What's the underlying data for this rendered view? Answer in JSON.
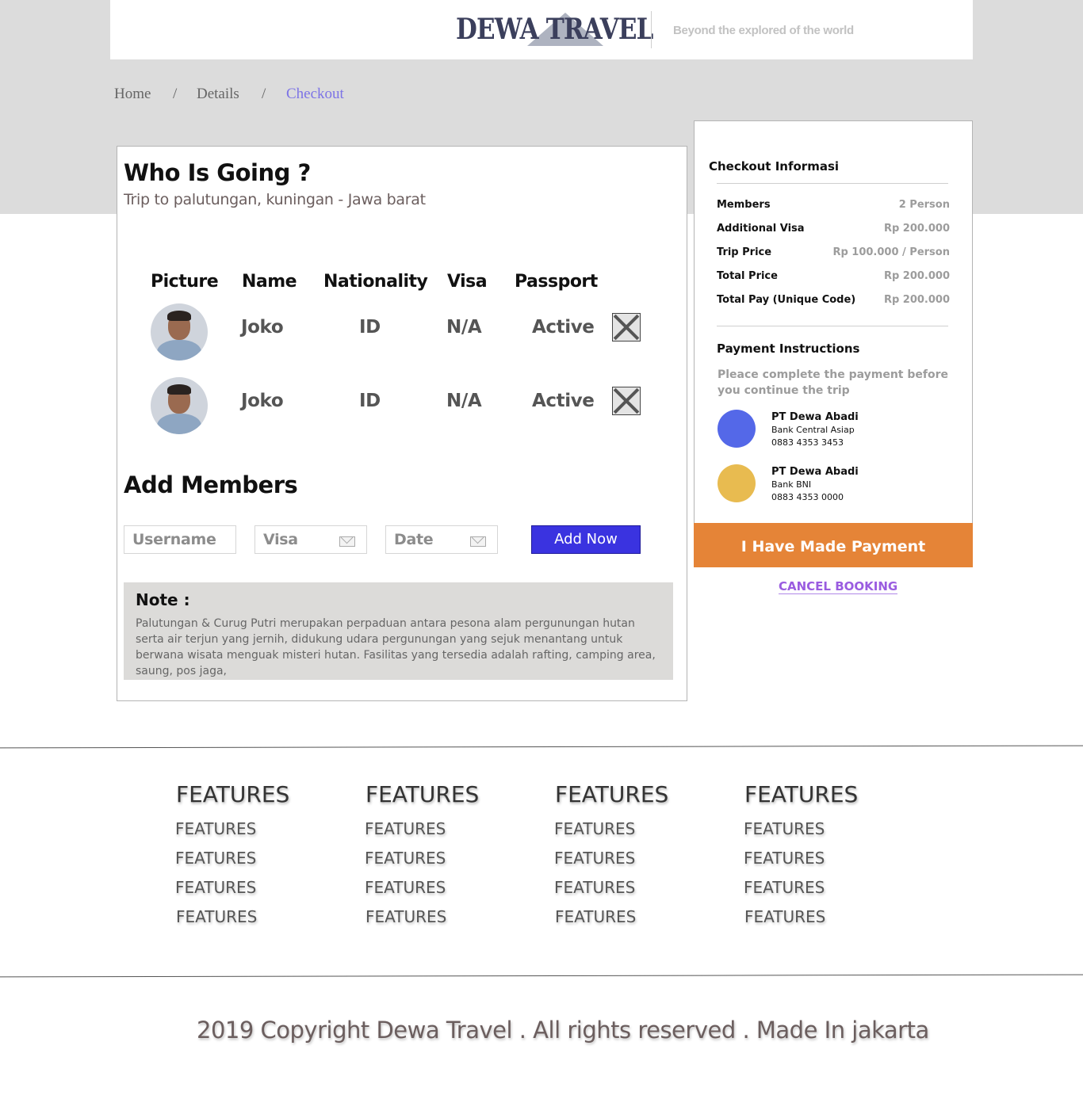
{
  "brand": {
    "logo_text": "DEWA TRAVEL",
    "tagline": "Beyond the explored of the world"
  },
  "breadcrumb": {
    "items": [
      "Home",
      "Details",
      "Checkout"
    ],
    "separator": "/"
  },
  "trip": {
    "title": "Who Is Going ?",
    "subtitle": "Trip to palutungan, kuningan - Jawa barat",
    "columns": [
      "Picture",
      "Name",
      "Nationality",
      "Visa",
      "Passport"
    ],
    "members": [
      {
        "name": "Joko",
        "nationality": "ID",
        "visa": "N/A",
        "passport": "Active"
      },
      {
        "name": "Joko",
        "nationality": "ID",
        "visa": "N/A",
        "passport": "Active"
      }
    ]
  },
  "add_members": {
    "title": "Add Members",
    "username_placeholder": "Username",
    "visa_placeholder": "Visa",
    "date_placeholder": "Date",
    "button_label": "Add Now"
  },
  "note": {
    "title": "Note :",
    "text": "Palutungan & Curug Putri merupakan perpaduan antara pesona alam pergunungan hutan serta air terjun yang jernih, didukung udara pergunungan yang sejuk menantang untuk berwana wisata menguak misteri hutan. Fasilitas yang tersedia adalah rafting, camping area, saung, pos jaga,"
  },
  "checkout": {
    "title": "Checkout Informasi",
    "rows": [
      {
        "label": "Members",
        "value": "2 Person"
      },
      {
        "label": "Additional Visa",
        "value": "Rp 200.000"
      },
      {
        "label": "Trip Price",
        "value": "Rp 100.000 / Person"
      },
      {
        "label": "Total Price",
        "value": "Rp 200.000"
      },
      {
        "label": "Total Pay (Unique Code)",
        "value": "Rp 200.000"
      }
    ],
    "payment_title": "Payment Instructions",
    "payment_text": "Pleace complete the payment before you continue the trip",
    "banks": [
      {
        "company": "PT Dewa Abadi",
        "bank": "Bank Central Asiap",
        "account": "0883 4353 3453",
        "color": "#5468e8"
      },
      {
        "company": "PT Dewa Abadi",
        "bank": "Bank BNI",
        "account": "0883 4353 0000",
        "color": "#e8bb50"
      }
    ],
    "pay_button": "I Have Made Payment",
    "cancel_link": "CANCEL BOOKING"
  },
  "footer": {
    "columns": [
      {
        "heading": "FEATURES",
        "items": [
          "FEATURES",
          "FEATURES",
          "FEATURES",
          "FEATURES"
        ]
      },
      {
        "heading": "FEATURES",
        "items": [
          "FEATURES",
          "FEATURES",
          "FEATURES",
          "FEATURES"
        ]
      },
      {
        "heading": "FEATURES",
        "items": [
          "FEATURES",
          "FEATURES",
          "FEATURES",
          "FEATURES"
        ]
      },
      {
        "heading": "FEATURES",
        "items": [
          "FEATURES",
          "FEATURES",
          "FEATURES",
          "FEATURES"
        ]
      }
    ],
    "copyright": "2019 Copyright Dewa Travel . All rights reserved . Made In jakarta"
  }
}
